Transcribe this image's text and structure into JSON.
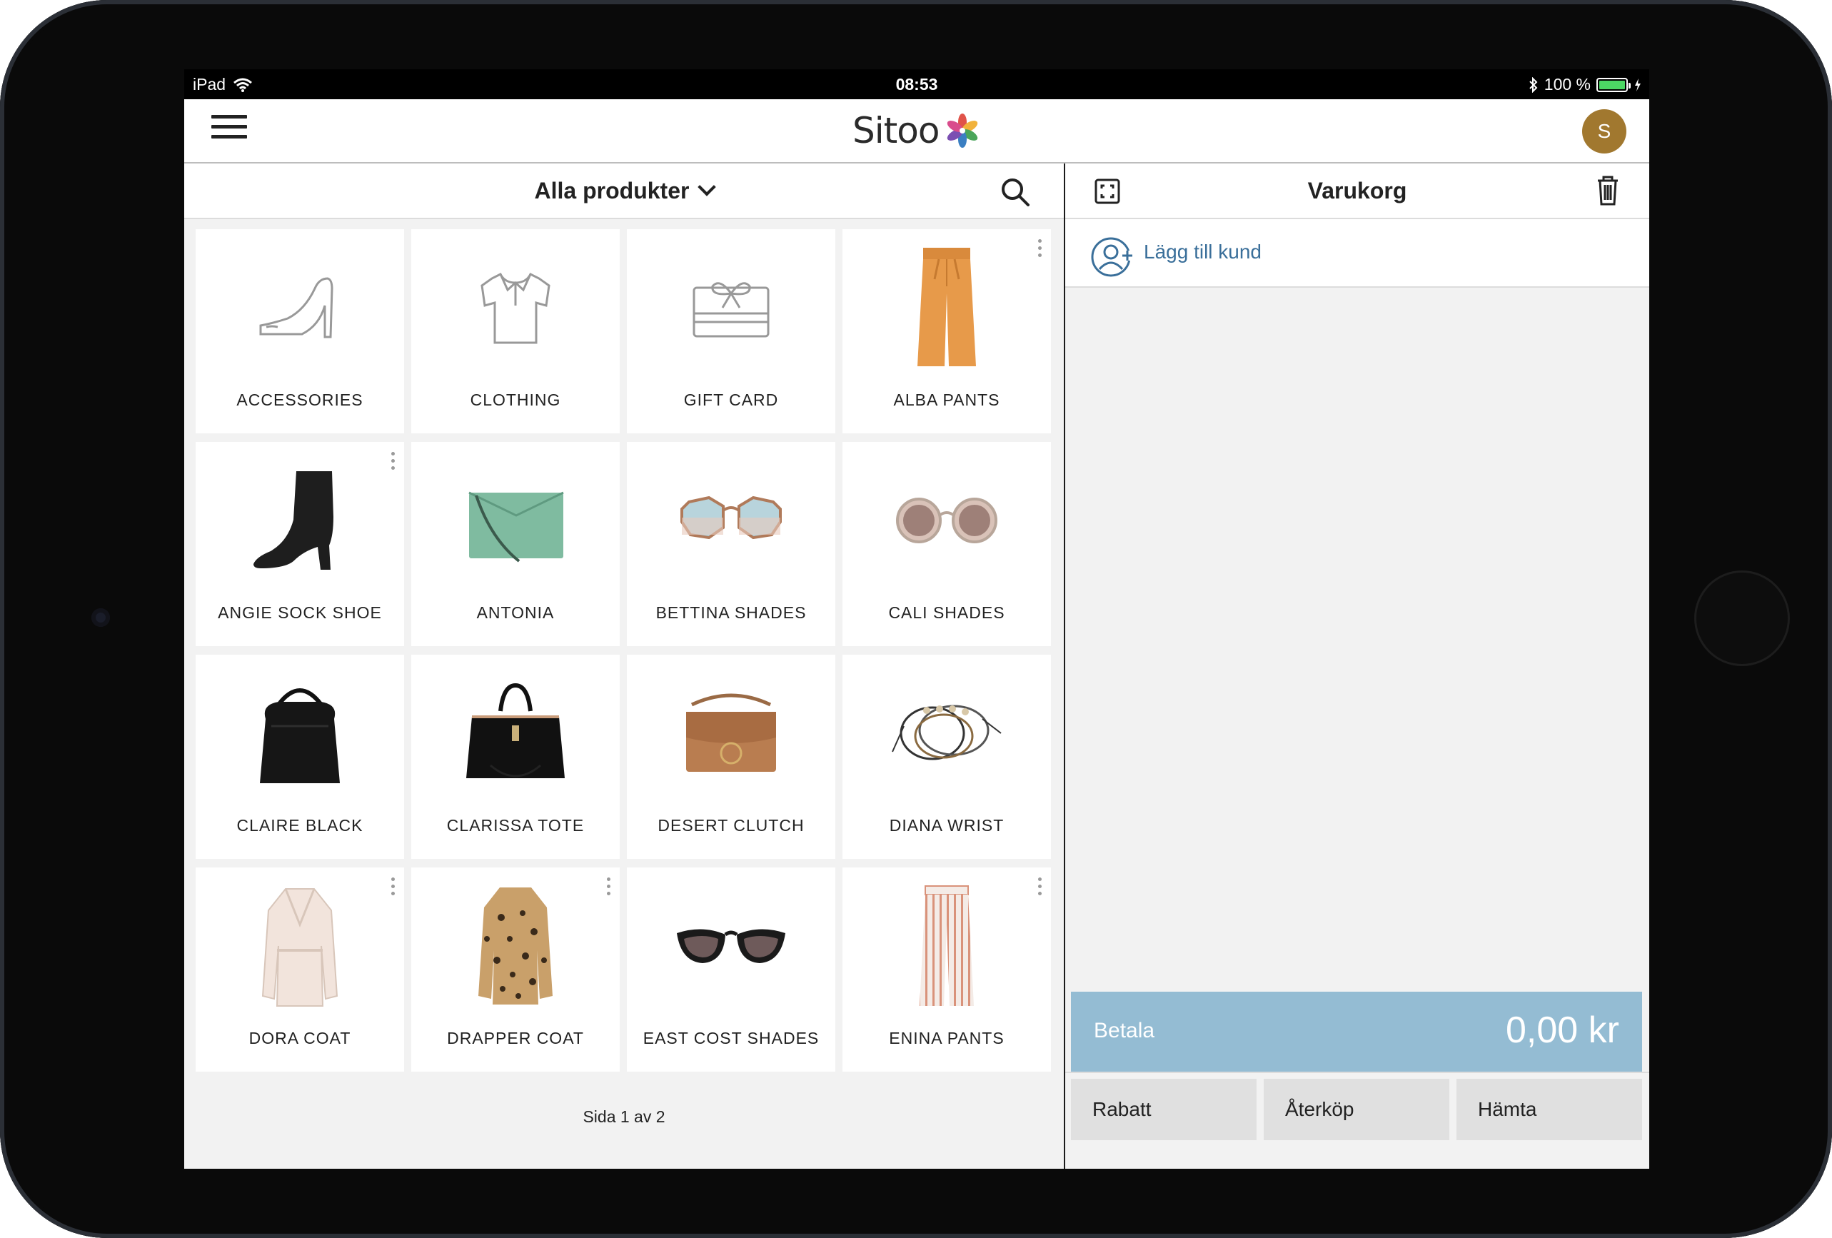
{
  "status_bar": {
    "device": "iPad",
    "time": "08:53",
    "battery": "100 %",
    "battery_level": 1.0
  },
  "header": {
    "logo_text": "Sitoo",
    "avatar_initial": "S"
  },
  "catalog": {
    "title": "Alla produkter",
    "page_label": "Sida 1 av 2",
    "tiles": [
      {
        "label": "ACCESSORIES",
        "icon": "shoe-outline-icon"
      },
      {
        "label": "CLOTHING",
        "icon": "shirt-outline-icon"
      },
      {
        "label": "GIFT CARD",
        "icon": "gift-card-outline-icon"
      },
      {
        "label": "ALBA PANTS",
        "icon": "orange-pants-photo"
      },
      {
        "label": "ANGIE SOCK SHOE",
        "icon": "black-boot-photo"
      },
      {
        "label": "ANTONIA",
        "icon": "green-bag-photo"
      },
      {
        "label": "BETTINA SHADES",
        "icon": "octagon-sunglasses-photo"
      },
      {
        "label": "CALI SHADES",
        "icon": "round-sunglasses-photo"
      },
      {
        "label": "CLAIRE BLACK",
        "icon": "black-hobo-bag-photo"
      },
      {
        "label": "CLARISSA TOTE",
        "icon": "black-tote-photo"
      },
      {
        "label": "DESERT CLUTCH",
        "icon": "brown-bag-photo"
      },
      {
        "label": "DIANA WRIST",
        "icon": "bracelets-photo"
      },
      {
        "label": "DORA COAT",
        "icon": "beige-coat-photo"
      },
      {
        "label": "DRAPPER COAT",
        "icon": "leopard-coat-photo"
      },
      {
        "label": "EAST COST SHADES",
        "icon": "cat-eye-sunglasses-photo"
      },
      {
        "label": "ENINA PANTS",
        "icon": "striped-pants-photo"
      }
    ]
  },
  "cart": {
    "title": "Varukorg",
    "add_customer": "Lägg till kund",
    "actions": {
      "discount": "Rabatt",
      "return": "Återköp",
      "retrieve": "Hämta"
    },
    "pay": {
      "label": "Betala",
      "amount": "0,00 kr"
    }
  },
  "colors": {
    "accent_blue": "#94bcd3",
    "link_blue": "#3a6f9a",
    "avatar_bg": "#a1782f"
  }
}
